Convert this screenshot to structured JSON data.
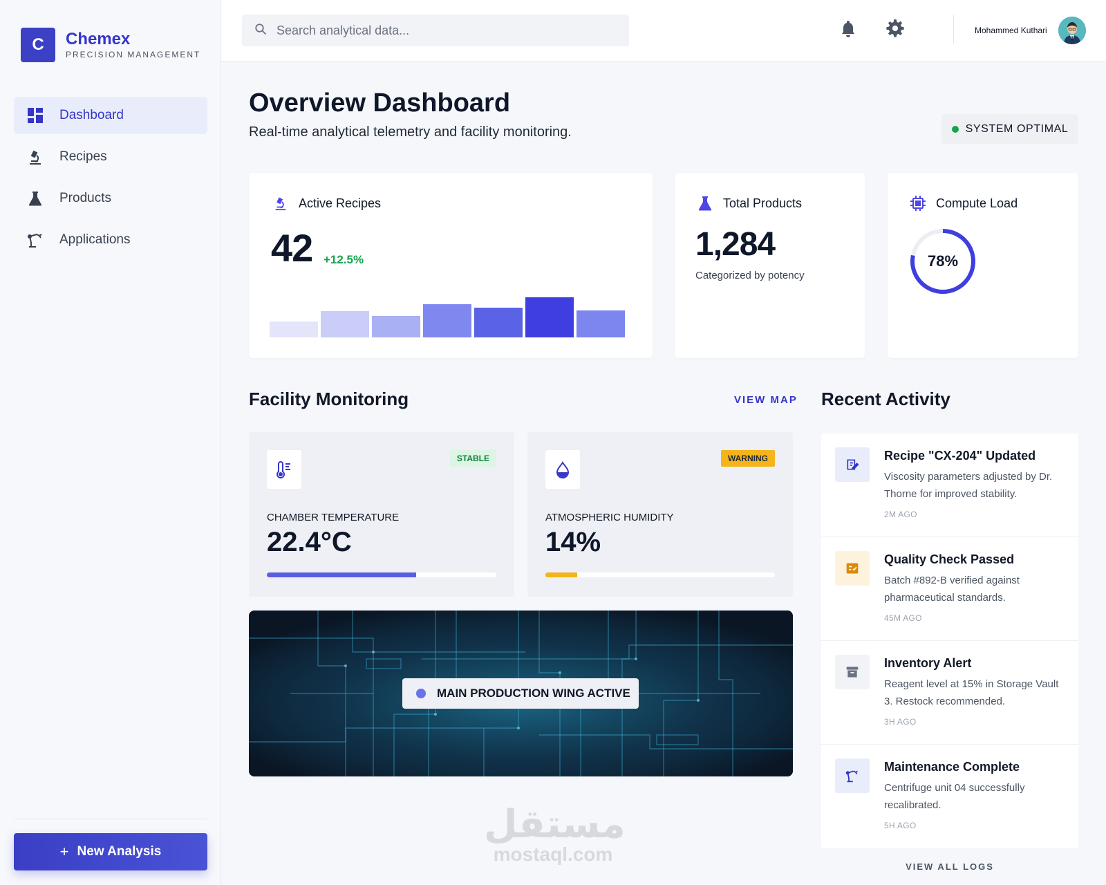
{
  "brand": {
    "logo_letter": "C",
    "name": "Chemex",
    "tagline": "PRECISION MANAGEMENT"
  },
  "sidebar": {
    "items": [
      {
        "label": "Dashboard",
        "icon": "dashboard-icon",
        "active": true
      },
      {
        "label": "Recipes",
        "icon": "microscope-icon",
        "active": false
      },
      {
        "label": "Products",
        "icon": "flask-icon",
        "active": false
      },
      {
        "label": "Applications",
        "icon": "robot-arm-icon",
        "active": false
      }
    ],
    "new_analysis": {
      "plus": "+",
      "label": "New Analysis"
    }
  },
  "topbar": {
    "search_placeholder": "Search analytical data...",
    "user_name": "Mohammed Kuthari"
  },
  "header": {
    "title": "Overview Dashboard",
    "subtitle": "Real-time analytical telemetry and facility monitoring.",
    "status": "SYSTEM OPTIMAL"
  },
  "cards": {
    "active_recipes": {
      "label": "Active Recipes",
      "value": "42",
      "trend": "+12.5%",
      "bars": [
        {
          "value": 0.4,
          "color": "#e3e6fb"
        },
        {
          "value": 0.65,
          "color": "#c9cdf8"
        },
        {
          "value": 0.53,
          "color": "#a9b0f3"
        },
        {
          "value": 0.82,
          "color": "#7f88ef"
        },
        {
          "value": 0.74,
          "color": "#5a62e6"
        },
        {
          "value": 1.0,
          "color": "#3f3ee0"
        },
        {
          "value": 0.67,
          "color": "#7c86ee"
        }
      ]
    },
    "total_products": {
      "label": "Total Products",
      "value": "1,284",
      "caption": "Categorized by potency"
    },
    "compute_load": {
      "label": "Compute Load",
      "value": "78%",
      "percent": 78
    }
  },
  "facility": {
    "title": "Facility Monitoring",
    "view_map": "VIEW MAP",
    "metrics": [
      {
        "label": "CHAMBER TEMPERATURE",
        "value": "22.4°C",
        "status": "STABLE",
        "progress": 0.65,
        "color": "#5a5fe0"
      },
      {
        "label": "ATMOSPHERIC HUMIDITY",
        "value": "14%",
        "status": "WARNING",
        "progress": 0.14,
        "color": "#f2b417"
      }
    ],
    "banner": "MAIN PRODUCTION WING ACTIVE"
  },
  "activity": {
    "title": "Recent Activity",
    "items": [
      {
        "title": "Recipe \"CX-204\" Updated",
        "desc": "Viscosity parameters adjusted by Dr. Thorne for improved stability.",
        "time": "2M AGO",
        "icon": "edit-document-icon"
      },
      {
        "title": "Quality Check Passed",
        "desc": "Batch #892-B verified against pharmaceutical standards.",
        "time": "45M AGO",
        "icon": "checklist-icon"
      },
      {
        "title": "Inventory Alert",
        "desc": "Reagent level at 15% in Storage Vault 3. Restock recommended.",
        "time": "3H AGO",
        "icon": "archive-box-icon"
      },
      {
        "title": "Maintenance Complete",
        "desc": "Centrifuge unit 04 successfully recalibrated.",
        "time": "5H AGO",
        "icon": "robot-arm-icon"
      }
    ],
    "view_all": "VIEW ALL LOGS"
  },
  "watermark": {
    "arabic": "مستقل",
    "latin": "mostaql.com"
  }
}
